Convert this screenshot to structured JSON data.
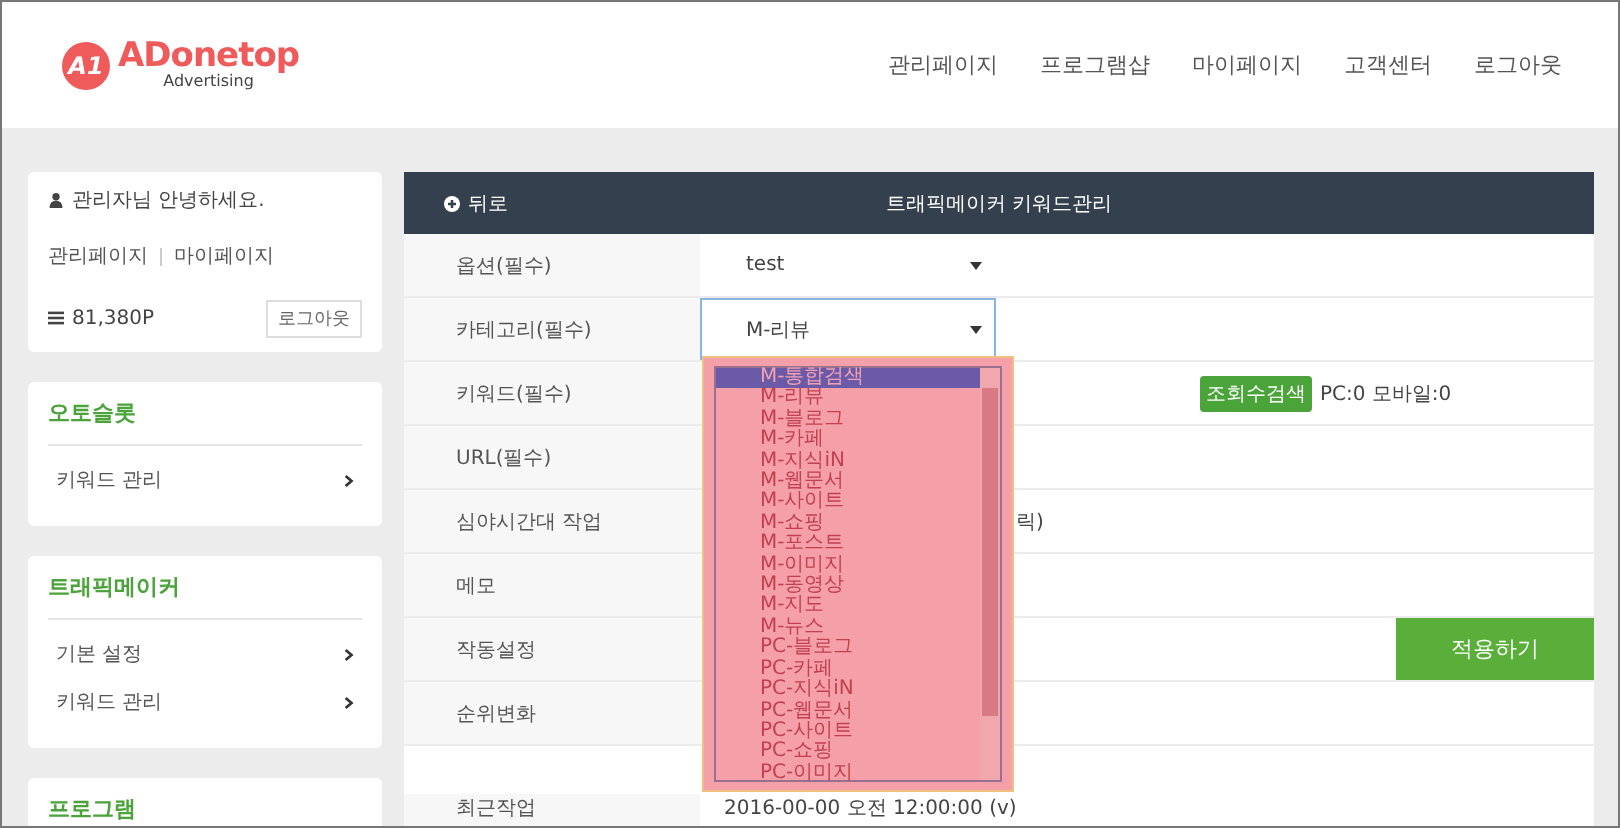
{
  "header": {
    "logo": {
      "mark": "A1",
      "name": "ADonetop",
      "tagline": "Advertising"
    },
    "nav": [
      "관리페이지",
      "프로그램샵",
      "마이페이지",
      "고객센터",
      "로그아웃"
    ]
  },
  "user_card": {
    "greeting": "관리자님 안녕하세요.",
    "links": [
      "관리페이지",
      "마이페이지"
    ],
    "points": "81,380P",
    "logout": "로그아웃"
  },
  "sidebar": [
    {
      "title": "오토슬롯",
      "items": [
        "키워드 관리"
      ]
    },
    {
      "title": "트래픽메이커",
      "items": [
        "기본 설정",
        "키워드 관리"
      ]
    },
    {
      "title": "프로그램"
    }
  ],
  "panel": {
    "back": "뒤로",
    "title": "트래픽메이커 키워드관리",
    "rows": [
      {
        "label": "옵션(필수)",
        "kind": "select",
        "value": "test",
        "focused": false
      },
      {
        "label": "카테고리(필수)",
        "kind": "select",
        "value": "M-리뷰",
        "focused": true
      },
      {
        "label": "키워드(필수)",
        "kind": "search",
        "button": "조회수검색",
        "result": "PC:0 모바일:0"
      },
      {
        "label": "URL(필수)",
        "kind": "empty"
      },
      {
        "label": "심야시간대 작업",
        "kind": "covered",
        "value": "릭)"
      },
      {
        "label": "메모",
        "kind": "empty"
      },
      {
        "label": "작동설정",
        "kind": "apply",
        "button": "적용하기"
      },
      {
        "label": "순위변화",
        "kind": "empty"
      },
      {
        "label": "최근작업",
        "kind": "text",
        "value": "2016-00-00 오전 12:00:00 (v)"
      }
    ]
  },
  "dropdown": {
    "options": [
      {
        "label": "M-통합검색",
        "selected": true
      },
      {
        "label": "M-리뷰",
        "selected": false
      },
      {
        "label": "M-블로그",
        "selected": false
      },
      {
        "label": "M-카페",
        "selected": false
      },
      {
        "label": "M-지식iN",
        "selected": false
      },
      {
        "label": "M-웹문서",
        "selected": false
      },
      {
        "label": "M-사이트",
        "selected": false
      },
      {
        "label": "M-쇼핑",
        "selected": false
      },
      {
        "label": "M-포스트",
        "selected": false
      },
      {
        "label": "M-이미지",
        "selected": false
      },
      {
        "label": "M-동영상",
        "selected": false
      },
      {
        "label": "M-지도",
        "selected": false
      },
      {
        "label": "M-뉴스",
        "selected": false
      },
      {
        "label": "PC-블로그",
        "selected": false
      },
      {
        "label": "PC-카페",
        "selected": false
      },
      {
        "label": "PC-지식iN",
        "selected": false
      },
      {
        "label": "PC-웹문서",
        "selected": false
      },
      {
        "label": "PC-사이트",
        "selected": false
      },
      {
        "label": "PC-쇼핑",
        "selected": false
      },
      {
        "label": "PC-이미지",
        "selected": false
      }
    ]
  }
}
